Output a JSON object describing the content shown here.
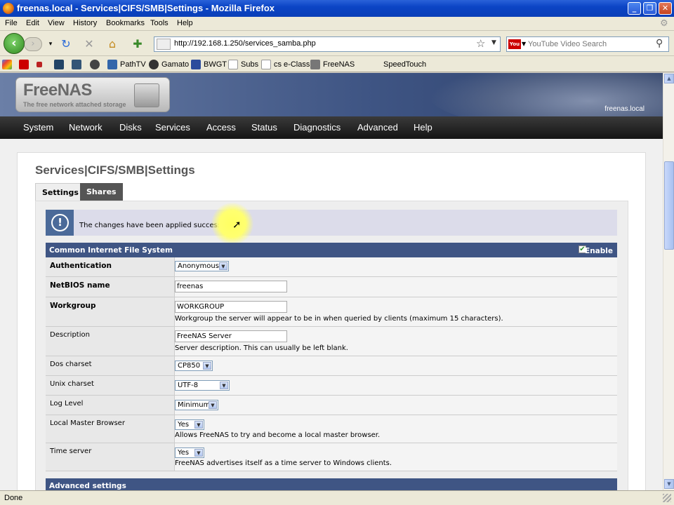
{
  "window": {
    "title": "freenas.local - Services|CIFS/SMB|Settings - Mozilla Firefox"
  },
  "menu": [
    "File",
    "Edit",
    "View",
    "History",
    "Bookmarks",
    "Tools",
    "Help"
  ],
  "address": {
    "url": "http://192.168.1.250/services_samba.php"
  },
  "search": {
    "placeholder": "YouTube Video Search"
  },
  "bookmarks": [
    "PathTV",
    "Gamato",
    "BWGT",
    "Subs",
    "cs e-Class",
    "FreeNAS",
    "SpeedTouch"
  ],
  "site": {
    "logo_title": "FreeNAS",
    "logo_subtitle": "The free network attached storage",
    "hostname": "freenas.local",
    "nav": [
      "System",
      "Network",
      "Disks",
      "Services",
      "Access",
      "Status",
      "Diagnostics",
      "Advanced",
      "Help"
    ]
  },
  "page": {
    "title": "Services|CIFS/SMB|Settings",
    "tabs": [
      "Settings",
      "Shares"
    ],
    "info_message": "The changes have been applied successfully.",
    "section_title": "Common Internet File System",
    "enable_label": "Enable",
    "rows": {
      "authentication": {
        "label": "Authentication",
        "value": "Anonymous"
      },
      "netbios": {
        "label": "NetBIOS name",
        "value": "freenas"
      },
      "workgroup": {
        "label": "Workgroup",
        "value": "WORKGROUP",
        "hint": "Workgroup the server will appear to be in when queried by clients (maximum 15 characters)."
      },
      "description": {
        "label": "Description",
        "value": "FreeNAS Server",
        "hint": "Server description. This can usually be left blank."
      },
      "dos_charset": {
        "label": "Dos charset",
        "value": "CP850"
      },
      "unix_charset": {
        "label": "Unix charset",
        "value": "UTF-8"
      },
      "log_level": {
        "label": "Log Level",
        "value": "Minimum"
      },
      "local_master": {
        "label": "Local Master Browser",
        "value": "Yes",
        "hint": "Allows FreeNAS to try and become a local master browser."
      },
      "time_server": {
        "label": "Time server",
        "value": "Yes",
        "hint": "FreeNAS advertises itself as a time server to Windows clients."
      }
    },
    "advanced_title": "Advanced settings"
  },
  "status": {
    "text": "Done"
  }
}
